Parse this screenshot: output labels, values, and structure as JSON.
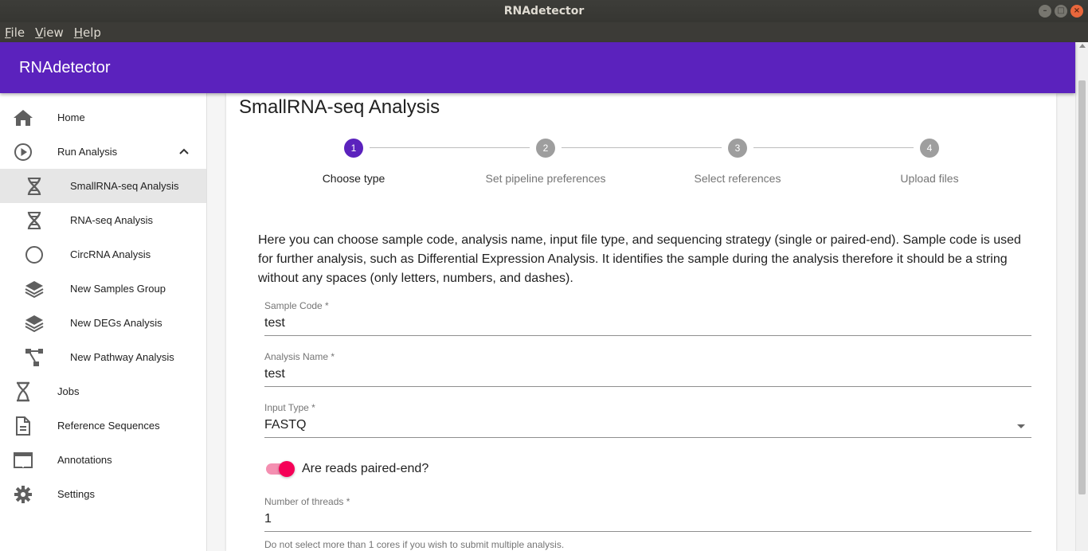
{
  "window": {
    "title": "RNAdetector"
  },
  "menubar": {
    "items": [
      "File",
      "View",
      "Help"
    ]
  },
  "appbar": {
    "title": "RNAdetector",
    "color": "#5b22bd"
  },
  "sidebar": {
    "items": [
      {
        "label": "Home",
        "icon": "home-icon"
      },
      {
        "label": "Run Analysis",
        "icon": "play-circle-icon",
        "expanded": true
      },
      {
        "label": "SmallRNA-seq Analysis",
        "icon": "dna-icon",
        "sub": true,
        "active": true
      },
      {
        "label": "RNA-seq Analysis",
        "icon": "dna-icon",
        "sub": true
      },
      {
        "label": "CircRNA Analysis",
        "icon": "circle-icon",
        "sub": true
      },
      {
        "label": "New Samples Group",
        "icon": "layers-icon",
        "sub": true
      },
      {
        "label": "New DEGs Analysis",
        "icon": "layers-icon",
        "sub": true
      },
      {
        "label": "New Pathway Analysis",
        "icon": "pathway-icon",
        "sub": true
      },
      {
        "label": "Jobs",
        "icon": "hourglass-icon"
      },
      {
        "label": "Reference Sequences",
        "icon": "file-icon"
      },
      {
        "label": "Annotations",
        "icon": "table-icon"
      },
      {
        "label": "Settings",
        "icon": "gear-icon"
      }
    ]
  },
  "page": {
    "title": "SmallRNA-seq Analysis",
    "steps": [
      {
        "number": "1",
        "label": "Choose type",
        "active": true
      },
      {
        "number": "2",
        "label": "Set pipeline preferences"
      },
      {
        "number": "3",
        "label": "Select references"
      },
      {
        "number": "4",
        "label": "Upload files"
      }
    ],
    "intro": "Here you can choose sample code, analysis name, input file type, and sequencing strategy (single or paired-end). Sample code is used for further analysis, such as Differential Expression Analysis. It identifies the sample during the analysis therefore it should be a string without any spaces (only letters, numbers, and dashes).",
    "fields": {
      "sample_code": {
        "label": "Sample Code *",
        "value": "test"
      },
      "analysis_name": {
        "label": "Analysis Name *",
        "value": "test"
      },
      "input_type": {
        "label": "Input Type *",
        "value": "FASTQ"
      },
      "paired_end": {
        "label": "Are reads paired-end?",
        "checked": true
      },
      "threads": {
        "label": "Number of threads *",
        "value": "1",
        "helper": "Do not select more than 1 cores if you wish to submit multiple analysis."
      }
    }
  },
  "colors": {
    "primary": "#5b22bd",
    "secondary": "#f50057"
  }
}
